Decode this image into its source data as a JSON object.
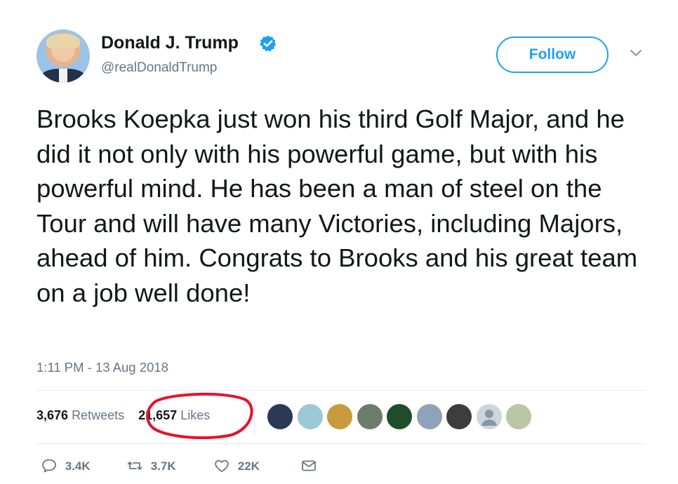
{
  "author": {
    "name": "Donald J. Trump",
    "handle": "@realDonaldTrump",
    "verified": true
  },
  "follow_label": "Follow",
  "tweet": {
    "text": "Brooks Koepka just won his third Golf Major, and he did it not only with his powerful game, but with his powerful mind. He has been a man of steel on the Tour and will have many Victories, including Majors, ahead of him. Congrats to Brooks and his great team on a job well done!",
    "timestamp": "1:11 PM - 13 Aug 2018"
  },
  "stats": {
    "retweets_count": "3,676",
    "retweets_label": "Retweets",
    "likes_count": "21,657",
    "likes_label": "Likes"
  },
  "likers": [
    {
      "icon": "liker-avatar-icon",
      "color": "#2b3a55"
    },
    {
      "icon": "liker-avatar-icon",
      "color": "#9cc8d8"
    },
    {
      "icon": "liker-avatar-icon",
      "color": "#c89a3c"
    },
    {
      "icon": "liker-avatar-icon",
      "color": "#6b7d6a"
    },
    {
      "icon": "liker-avatar-icon",
      "color": "#1f4d2a"
    },
    {
      "icon": "liker-avatar-icon",
      "color": "#8fa3b8"
    },
    {
      "icon": "liker-avatar-icon",
      "color": "#3d3d3d"
    },
    {
      "icon": "default-avatar-icon",
      "color": "#ccd6dd"
    },
    {
      "icon": "liker-avatar-icon",
      "color": "#b9c7a5"
    }
  ],
  "actions": {
    "reply_count": "3.4K",
    "retweet_count": "3.7K",
    "like_count": "22K"
  },
  "colors": {
    "accent": "#1da1f2",
    "text": "#14171a",
    "secondary": "#657786",
    "annotation": "#e8112d"
  }
}
